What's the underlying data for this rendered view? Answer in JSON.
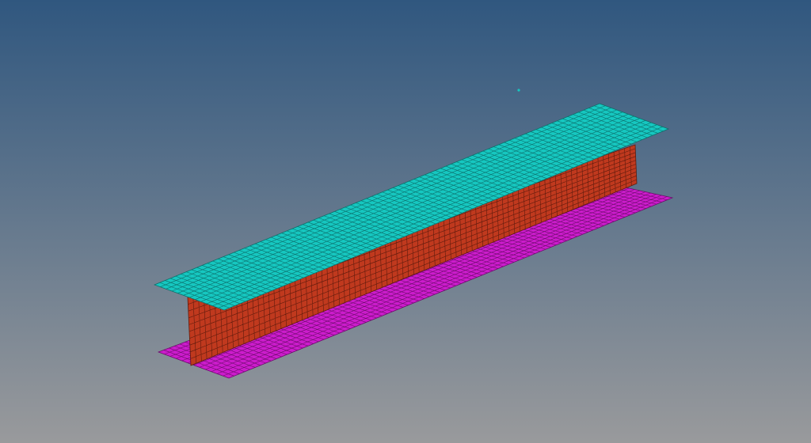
{
  "viewport": {
    "background_top": "#30577f",
    "background_bottom": "#999a9c"
  },
  "model": {
    "top_flange": {
      "color": "#16c7c0",
      "mesh_color": "#0c6f6b"
    },
    "web": {
      "color": "#c0391e",
      "mesh_color": "#5e1b0d"
    },
    "bottom_flange": {
      "color": "#cc1ccc",
      "mesh_color": "#6c0c6c"
    }
  },
  "mesh": {
    "length_divisions": 84,
    "flange_width_divisions": 12,
    "web_height_divisions": 10
  },
  "node_marker": {
    "color": "#16c7c0"
  }
}
